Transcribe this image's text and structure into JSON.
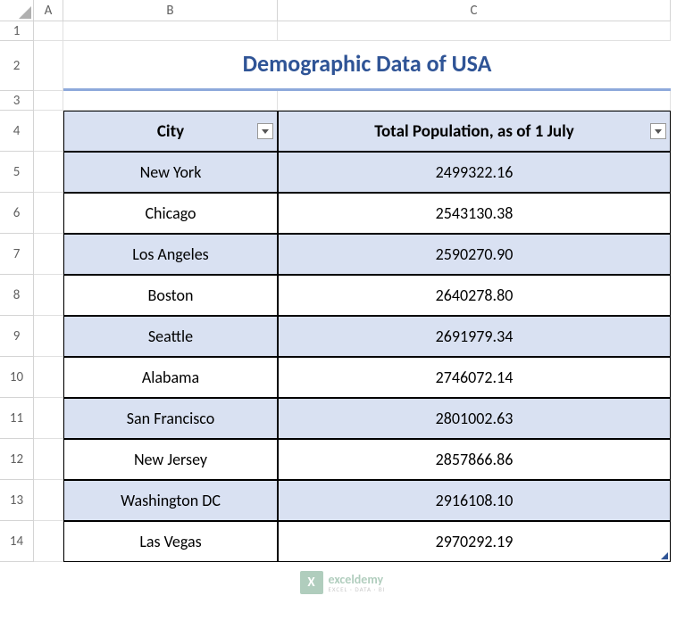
{
  "columns": [
    "A",
    "B",
    "C"
  ],
  "rows": [
    "1",
    "2",
    "3",
    "4",
    "5",
    "6",
    "7",
    "8",
    "9",
    "10",
    "11",
    "12",
    "13",
    "14"
  ],
  "title": "Demographic Data of USA",
  "headers": {
    "city": "City",
    "population": "Total Population, as of 1 July"
  },
  "data": [
    {
      "city": "New York",
      "population": "2499322.16"
    },
    {
      "city": "Chicago",
      "population": "2543130.38"
    },
    {
      "city": "Los Angeles",
      "population": "2590270.90"
    },
    {
      "city": "Boston",
      "population": "2640278.80"
    },
    {
      "city": "Seattle",
      "population": "2691979.34"
    },
    {
      "city": "Alabama",
      "population": "2746072.14"
    },
    {
      "city": "San Francisco",
      "population": "2801002.63"
    },
    {
      "city": "New Jersey",
      "population": "2857866.86"
    },
    {
      "city": "Washington DC",
      "population": "2916108.10"
    },
    {
      "city": "Las Vegas",
      "population": "2970292.19"
    }
  ],
  "watermark": {
    "title": "exceldemy",
    "sub": "EXCEL · DATA · BI"
  },
  "chart_data": {
    "type": "table",
    "title": "Demographic Data of USA",
    "columns": [
      "City",
      "Total Population, as of 1 July"
    ],
    "rows": [
      [
        "New York",
        2499322.16
      ],
      [
        "Chicago",
        2543130.38
      ],
      [
        "Los Angeles",
        2590270.9
      ],
      [
        "Boston",
        2640278.8
      ],
      [
        "Seattle",
        2691979.34
      ],
      [
        "Alabama",
        2746072.14
      ],
      [
        "San Francisco",
        2801002.63
      ],
      [
        "New Jersey",
        2857866.86
      ],
      [
        "Washington DC",
        2916108.1
      ],
      [
        "Las Vegas",
        2970292.19
      ]
    ]
  }
}
